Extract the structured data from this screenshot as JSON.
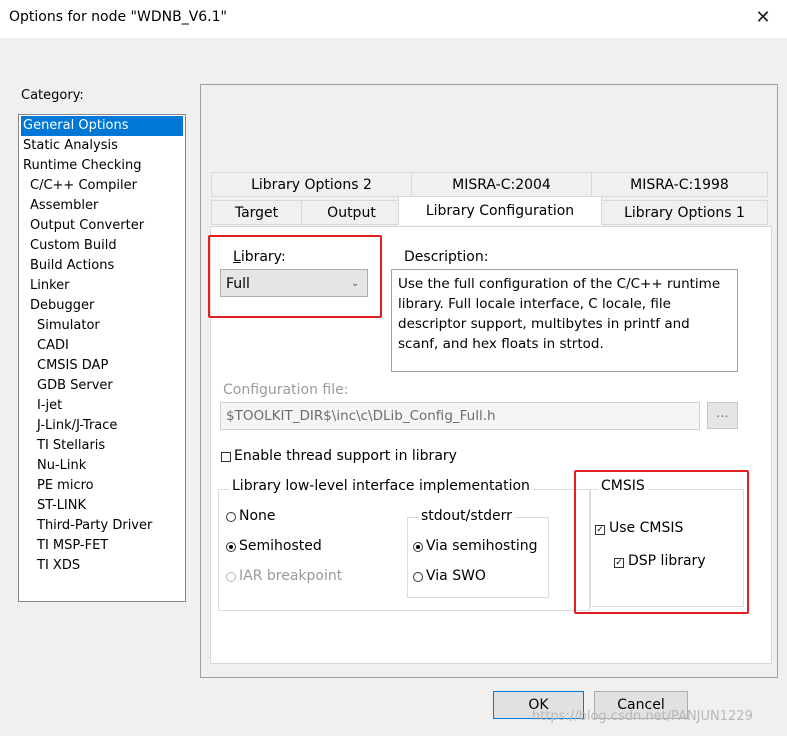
{
  "window": {
    "title": "Options for node \"WDNB_V6.1\""
  },
  "category": {
    "label": "Category:",
    "items": [
      "General Options",
      "Static Analysis",
      "Runtime Checking",
      "C/C++ Compiler",
      "Assembler",
      "Output Converter",
      "Custom Build",
      "Build Actions",
      "Linker",
      "Debugger",
      "Simulator",
      "CADI",
      "CMSIS DAP",
      "GDB Server",
      "I-jet",
      "J-Link/J-Trace",
      "TI Stellaris",
      "Nu-Link",
      "PE micro",
      "ST-LINK",
      "Third-Party Driver",
      "TI MSP-FET",
      "TI XDS"
    ],
    "selected": "General Options"
  },
  "tabs": {
    "row1": [
      "Library Options 2",
      "MISRA-C:2004",
      "MISRA-C:1998"
    ],
    "row2": [
      "Target",
      "Output",
      "Library Configuration",
      "Library Options 1"
    ],
    "active": "Library Configuration"
  },
  "library": {
    "label": "Library:",
    "value": "Full"
  },
  "description": {
    "label": "Description:",
    "text": "Use the full configuration of the C/C++ runtime library. Full locale interface, C locale, file descriptor support, multibytes in printf and scanf, and hex floats in strtod."
  },
  "config_file": {
    "label": "Configuration file:",
    "value": "$TOOLKIT_DIR$\\inc\\c\\DLib_Config_Full.h",
    "browse_label": "..."
  },
  "thread_support": {
    "label": "Enable thread support in library",
    "checked": false
  },
  "lowlevel": {
    "label": "Library low-level interface implementation",
    "options": [
      "None",
      "Semihosted",
      "IAR breakpoint"
    ],
    "selected": "Semihosted"
  },
  "stdout": {
    "label": "stdout/stderr",
    "options": [
      "Via semihosting",
      "Via SWO"
    ],
    "selected": "Via semihosting"
  },
  "cmsis": {
    "label": "CMSIS",
    "use_cmsis": {
      "label": "Use CMSIS",
      "checked": true
    },
    "dsp_library": {
      "label": "DSP library",
      "checked": true
    }
  },
  "buttons": {
    "ok": "OK",
    "cancel": "Cancel"
  },
  "watermark": "https://blog.csdn.net/PANJUN1229",
  "colors": {
    "selection": "#0078d7",
    "highlight_box": "#e02020"
  },
  "icons": {
    "close": "close-icon",
    "dropdown": "chevron-down-icon"
  }
}
